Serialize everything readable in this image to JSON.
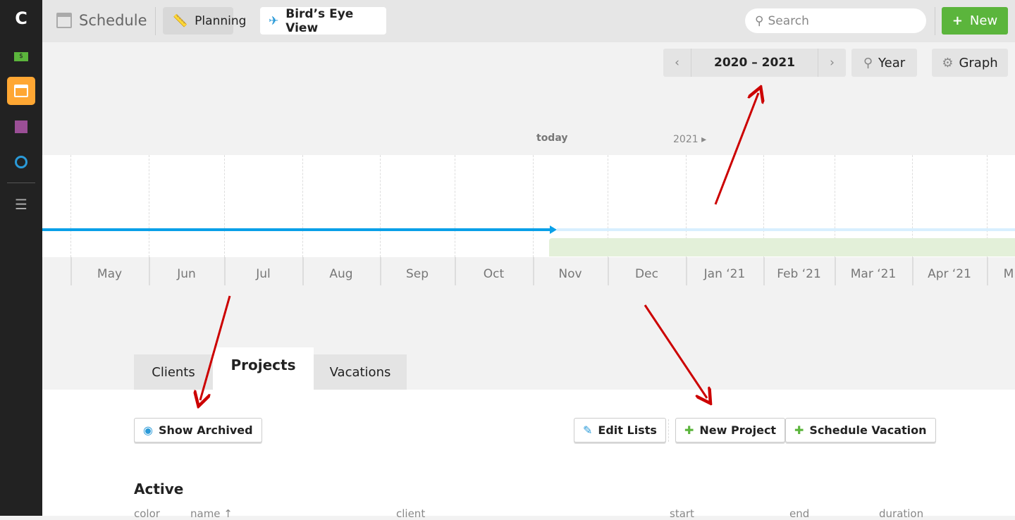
{
  "sidebar": {
    "logo": "C",
    "items": [
      {
        "icon": "money-icon",
        "color": "#5bb53c"
      },
      {
        "icon": "calendar-icon",
        "color": "#ffa733",
        "active": true
      },
      {
        "icon": "documents-icon",
        "color": "#9b4f96"
      },
      {
        "icon": "stopwatch-icon",
        "color": "#2a9ad8"
      },
      {
        "icon": "list-icon",
        "color": "#aaa"
      }
    ]
  },
  "header": {
    "title": "Schedule",
    "tabs": [
      {
        "label": "Planning"
      },
      {
        "label": "Bird’s Eye View",
        "active": true
      }
    ],
    "search_placeholder": "Search",
    "new_label": "New"
  },
  "toolbar": {
    "range": "2020 – 2021",
    "zoom_label": "Year",
    "graph_label": "Graph"
  },
  "timeline": {
    "today_label": "today",
    "year_marker": "2021 ▸",
    "months": [
      "May",
      "Jun",
      "Jul",
      "Aug",
      "Sep",
      "Oct",
      "Nov",
      "Dec",
      "Jan ‘21",
      "Feb ‘21",
      "Mar ‘21",
      "Apr ‘21",
      "M"
    ]
  },
  "list_tabs": [
    {
      "label": "Clients"
    },
    {
      "label": "Projects",
      "active": true
    },
    {
      "label": "Vacations"
    }
  ],
  "actions": {
    "show_archived": "Show Archived",
    "edit_lists": "Edit Lists",
    "new_project": "New Project",
    "schedule_vacation": "Schedule Vacation"
  },
  "section": {
    "title": "Active",
    "columns": [
      "color",
      "name ↑",
      "client",
      "start",
      "end",
      "duration"
    ]
  },
  "colors": {
    "accent_green": "#5bb53c",
    "blue": "#0aa0e8",
    "annotation_red": "#cc0000"
  }
}
